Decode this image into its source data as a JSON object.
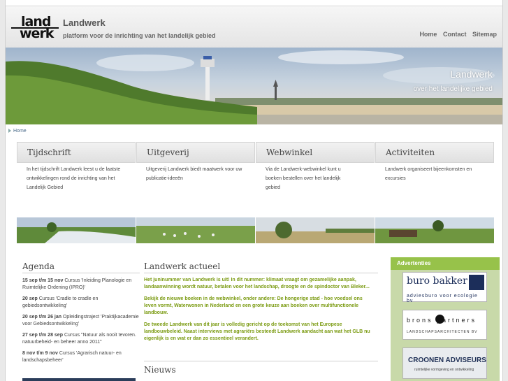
{
  "header": {
    "logo_top": "land",
    "logo_bottom": "werk",
    "title": "Landwerk",
    "tagline": "platform voor de inrichting van het landelijk gebied",
    "nav": [
      "Home",
      "Contact",
      "Sitemap"
    ]
  },
  "hero": {
    "title": "Landwerk",
    "subtitle": "over het landelijke gebied"
  },
  "breadcrumb": "Home",
  "sections": [
    {
      "title": "Tijdschrift",
      "text": "In het tijdschrift Landwerk leest u de laatste ontwikkelingen rond de inrichting van het Landelijk Gebied"
    },
    {
      "title": "Uitgeverij",
      "text": "Uitgeverij Landwerk biedt maatwerk voor uw publicatie-ideeën"
    },
    {
      "title": "Webwinkel",
      "text": "Via de Landwerk-webwinkel kunt u boeken bestellen over het landelijk gebied"
    },
    {
      "title": "Activiteiten",
      "text": "Landwerk organiseert bijeenkomsten en excursies"
    }
  ],
  "agenda": {
    "title": "Agenda",
    "items": [
      {
        "date": "15 sep t/m 15 nov",
        "text": "Cursus 'Inleiding Planologie en Ruimtelijke Ordening (IPRO)'"
      },
      {
        "date": "20 sep",
        "text": "Cursus 'Cradle to cradle en gebiedsontwikkeling'"
      },
      {
        "date": "20 sep t/m 26 jan",
        "text": "Opleidingstraject 'Praktijkacademie voor Gebiedsontwikkeling'"
      },
      {
        "date": "27 sep t/m 28 sep",
        "text": "Cursus \"Natuur als nooit tevoren. natuurbeheid- en beheer anno 2011\""
      },
      {
        "date": "8 nov t/m 9 nov",
        "text": "Cursus 'Agrarisch natuur- en landschapsbeheer'"
      }
    ]
  },
  "actueel": {
    "title": "Landwerk actueel",
    "items": [
      "Het juninummer van Landwerk is uit! In dit nummer: klimaat vraagt om gezamelijke aanpak, landaanwinning wordt natuur, betalen voor het landschap, droogte en de spindoctor van Bleker...",
      "Bekijk de nieuwe boeken in de webwinkel, onder andere: De hongerige stad - hoe voedsel ons leven vormt, Waterwonen in Nederland en een grote keuze aan boeken over multifunctionele landbouw.",
      "De tweede Landwerk van dit jaar is volledig gericht op de toekomst van het Europese landbouwbeleid. Naast interviews met agrariërs besteedt Landwerk aandacht aan wat het GLB nu eigenlijk is en wat er dan zo essentieel verandert."
    ]
  },
  "nieuws": {
    "title": "Nieuws"
  },
  "advertenties": {
    "title": "Advertenties",
    "ads": [
      {
        "name": "buro bakker",
        "tagline": "adviesburo voor ecologie bv"
      },
      {
        "name": "brons partners",
        "tagline": "LANDSCHAPSARCHITECTEN BV"
      },
      {
        "name": "CROONEN ADVISEURS",
        "tagline": "ruimtelijke vormgeving en ontwikkeling"
      }
    ]
  },
  "colors": {
    "accent_green": "#7b9b12",
    "ad_header": "#97c24a",
    "ad_bg": "#c8d9a9"
  }
}
